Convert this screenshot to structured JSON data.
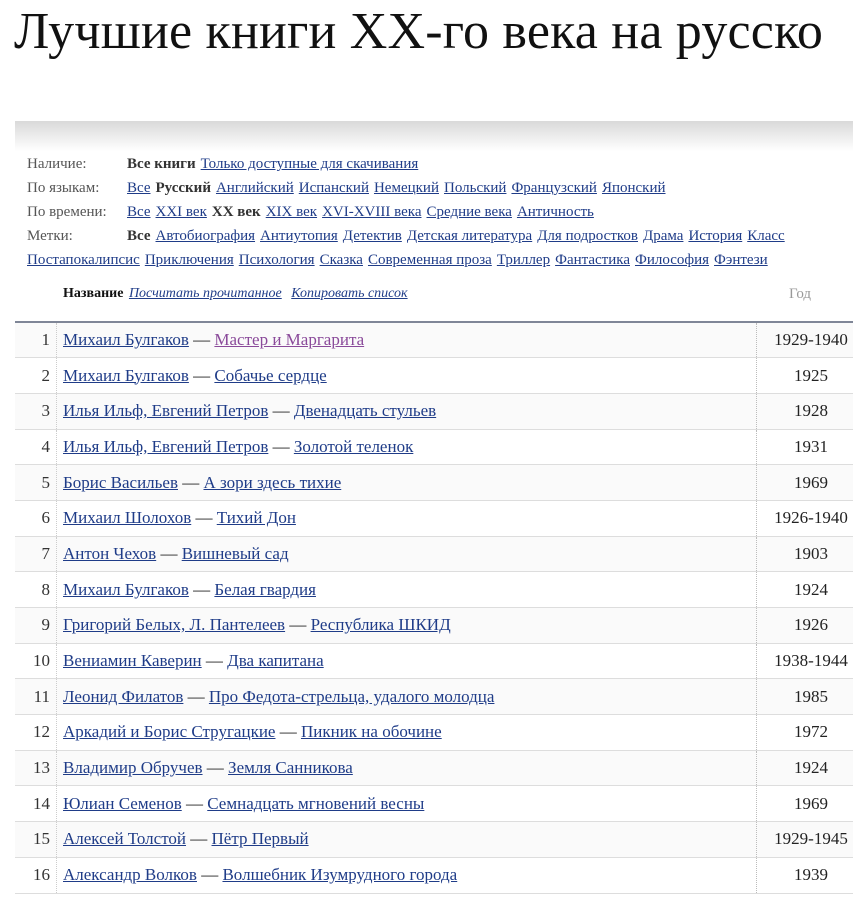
{
  "title": "Лучшие книги XX-го века на русско",
  "filters": {
    "availability": {
      "label": "Наличие:",
      "active": "Все книги",
      "links": [
        "Только доступные для скачивания"
      ]
    },
    "languages": {
      "label": "По языкам:",
      "before": [
        "Все"
      ],
      "active": "Русский",
      "after": [
        "Английский",
        "Испанский",
        "Немецкий",
        "Польский",
        "Французский",
        "Японский"
      ]
    },
    "time": {
      "label": "По времени:",
      "before": [
        "Все",
        "XXI век"
      ],
      "active": "XX век",
      "after": [
        "XIX век",
        "XVI-XVIII века",
        "Средние века",
        "Античность"
      ]
    },
    "tags": {
      "label": "Метки:",
      "active": "Все",
      "links": [
        "Автобиография",
        "Антиутопия",
        "Детектив",
        "Детская литература",
        "Для подростков",
        "Драма",
        "История",
        "Класс"
      ],
      "links2": [
        "Постапокалипсис",
        "Приключения",
        "Психология",
        "Сказка",
        "Современная проза",
        "Триллер",
        "Фантастика",
        "Философия",
        "Фэнтези"
      ]
    }
  },
  "table": {
    "name_header": "Название",
    "count_read_link": "Посчитать прочитанное",
    "copy_list_link": "Копировать список",
    "year_header": "Год",
    "rows": [
      {
        "num": "1",
        "author": "Михаил Булгаков",
        "book": "Мастер и Маргарита",
        "year": "1929-1940",
        "visited": true
      },
      {
        "num": "2",
        "author": "Михаил Булгаков",
        "book": "Собачье сердце",
        "year": "1925"
      },
      {
        "num": "3",
        "author": "Илья Ильф, Евгений Петров",
        "book": "Двенадцать стульев",
        "year": "1928"
      },
      {
        "num": "4",
        "author": "Илья Ильф, Евгений Петров",
        "book": "Золотой теленок",
        "year": "1931"
      },
      {
        "num": "5",
        "author": "Борис Васильев",
        "book": "А зори здесь тихие",
        "year": "1969"
      },
      {
        "num": "6",
        "author": "Михаил Шолохов",
        "book": "Тихий Дон",
        "year": "1926-1940"
      },
      {
        "num": "7",
        "author": "Антон Чехов",
        "book": "Вишневый сад",
        "year": "1903"
      },
      {
        "num": "8",
        "author": "Михаил Булгаков",
        "book": "Белая гвардия",
        "year": "1924"
      },
      {
        "num": "9",
        "author": "Григорий Белых, Л. Пантелеев",
        "book": "Республика ШКИД",
        "year": "1926"
      },
      {
        "num": "10",
        "author": "Вениамин Каверин",
        "book": "Два капитана",
        "year": "1938-1944"
      },
      {
        "num": "11",
        "author": "Леонид Филатов",
        "book": "Про Федота-стрельца, удалого молодца",
        "year": "1985"
      },
      {
        "num": "12",
        "author": "Аркадий и Борис Стругацкие",
        "book": "Пикник на обочине",
        "year": "1972"
      },
      {
        "num": "13",
        "author": "Владимир Обручев",
        "book": "Земля Санникова",
        "year": "1924"
      },
      {
        "num": "14",
        "author": "Юлиан Семенов",
        "book": "Семнадцать мгновений весны",
        "year": "1969"
      },
      {
        "num": "15",
        "author": "Алексей Толстой",
        "book": "Пётр Первый",
        "year": "1929-1945"
      },
      {
        "num": "16",
        "author": "Александр Волков",
        "book": "Волшебник Изумрудного города",
        "year": "1939"
      }
    ]
  }
}
